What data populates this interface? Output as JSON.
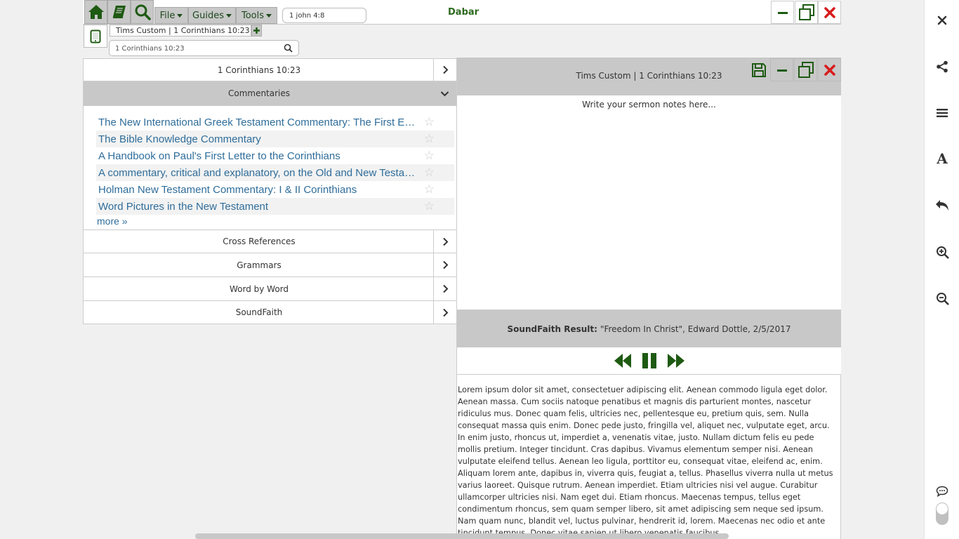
{
  "app": {
    "title": "Dabar"
  },
  "toolbar": {
    "menus": [
      {
        "label": "File"
      },
      {
        "label": "Guides"
      },
      {
        "label": "Tools"
      }
    ],
    "quick_search_value": "1 john 4:8"
  },
  "tab": {
    "title": "Tims Custom | 1 Corinthians 10:23"
  },
  "reference_search": {
    "value": "1 Corinthians 10:23"
  },
  "left_panel": {
    "passage_label": "1 Corinthians 10:23",
    "commentaries_label": "Commentaries",
    "commentaries": [
      {
        "title": "The New International Greek Testament Commentary: The First Epistle to the Corinthians"
      },
      {
        "title": "The Bible Knowledge Commentary"
      },
      {
        "title": "A Handbook on Paul's First Letter to the Corinthians"
      },
      {
        "title": "A commentary, critical and explanatory, on the Old and New Testaments"
      },
      {
        "title": "Holman New Testament Commentary: I & II Corinthians"
      },
      {
        "title": "Word Pictures in the New Testament"
      }
    ],
    "more_label": "more »",
    "sections": [
      {
        "label": "Cross References"
      },
      {
        "label": "Grammars"
      },
      {
        "label": "Word by Word"
      },
      {
        "label": "SoundFaith"
      }
    ]
  },
  "right_panel": {
    "title": "Tims Custom | 1 Corinthians 10:23",
    "notes_placeholder": "Write your sermon notes here...",
    "soundfaith_label": "SoundFaith Result:",
    "soundfaith_result": "\"Freedom In Christ\", Edward Dottle, 2/5/2017",
    "lorem": "Lorem ipsum dolor sit amet, consectetuer adipiscing elit. Aenean commodo ligula eget dolor. Aenean massa. Cum sociis natoque penatibus et magnis dis parturient montes, nascetur ridiculus mus. Donec quam felis, ultricies nec, pellentesque eu, pretium quis, sem. Nulla consequat massa quis enim. Donec pede justo, fringilla vel, aliquet nec, vulputate eget, arcu. In enim justo, rhoncus ut, imperdiet a, venenatis vitae, justo. Nullam dictum felis eu pede mollis pretium. Integer tincidunt. Cras dapibus. Vivamus elementum semper nisi. Aenean vulputate eleifend tellus. Aenean leo ligula, porttitor eu, consequat vitae, eleifend ac, enim. Aliquam lorem ante, dapibus in, viverra quis, feugiat a, tellus. Phasellus viverra nulla ut metus varius laoreet. Quisque rutrum. Aenean imperdiet. Etiam ultricies nisi vel augue. Curabitur ullamcorper ultricies nisi. Nam eget dui. Etiam rhoncus. Maecenas tempus, tellus eget condimentum rhoncus, sem quam semper libero, sit amet adipiscing sem neque sed ipsum. Nam quam nunc, blandit vel, luctus pulvinar, hendrerit id, lorem. Maecenas nec odio et ante tincidunt tempus. Donec vitae sapien ut libero venenatis faucibus"
  },
  "colors": {
    "accent_green": "#1e5a12",
    "close_red": "#d81b1b",
    "link_blue": "#2f6d9a",
    "panel_gray": "#c8c8c8"
  },
  "icons": {
    "nav": [
      "home-icon",
      "book-icon",
      "search-icon"
    ],
    "window": [
      "minimize-icon",
      "restore-icon",
      "close-icon"
    ],
    "panel": [
      "save-icon",
      "minimize-icon",
      "restore-icon",
      "close-icon"
    ],
    "player": [
      "rewind-icon",
      "pause-icon",
      "fast-forward-icon"
    ],
    "sidebar": [
      "close-icon",
      "share-icon",
      "menu-icon",
      "font-icon",
      "undo-icon",
      "zoom-in-icon",
      "zoom-out-icon",
      "chat-icon"
    ]
  }
}
